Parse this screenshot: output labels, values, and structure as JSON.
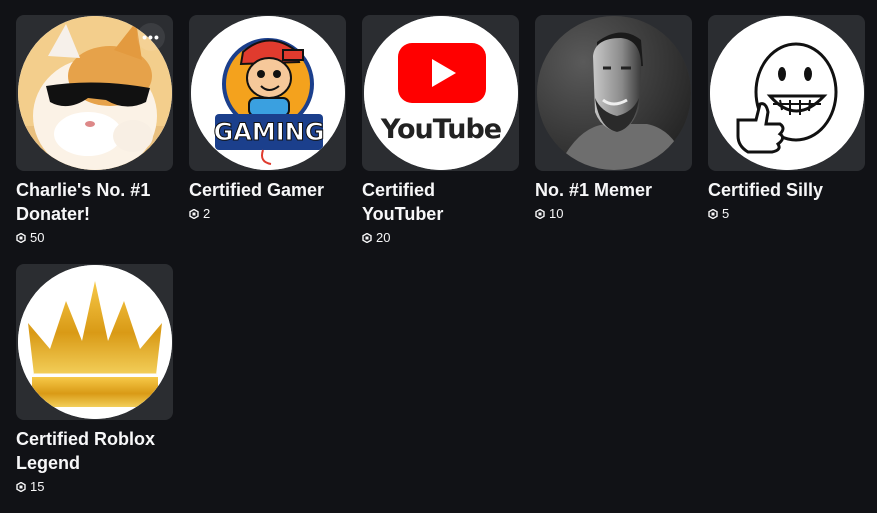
{
  "items": [
    {
      "name": "Charlie's No. #1 Donater!",
      "price": "50",
      "icon": "sunglasses-cat-image",
      "has_more_menu": true,
      "more_label": "•••"
    },
    {
      "name": "Certified Gamer",
      "price": "2",
      "icon": "gaming-logo-image",
      "logo_text": "GAMING"
    },
    {
      "name": "Certified YouTuber",
      "price": "20",
      "icon": "youtube-logo-image",
      "logo_text": "YouTube"
    },
    {
      "name": "No. #1 Memer",
      "price": "10",
      "icon": "gigachad-image"
    },
    {
      "name": "Certified Silly",
      "price": "5",
      "icon": "thumbs-up-smiley-image"
    },
    {
      "name": "Certified Roblox Legend",
      "price": "15",
      "icon": "gold-crown-image"
    }
  ],
  "colors": {
    "background": "#111216",
    "card": "#2b2d31",
    "text": "#f7f7f8",
    "youtube_red": "#ff0000",
    "crown_gold": "#e0a820"
  }
}
